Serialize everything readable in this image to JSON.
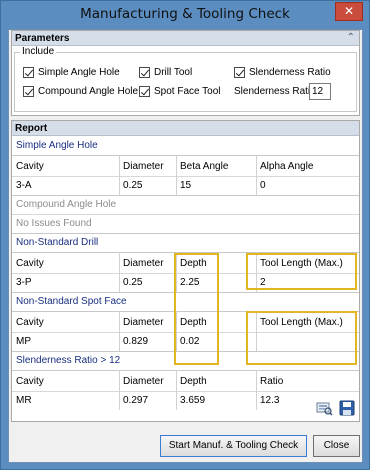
{
  "window": {
    "title": "Manufacturing & Tooling Check",
    "close_glyph": "✕"
  },
  "parameters": {
    "header": "Parameters",
    "collapse_glyph": "⌃",
    "group_label": "Include",
    "checkboxes": [
      {
        "label": "Simple Angle Hole",
        "checked": true
      },
      {
        "label": "Drill Tool",
        "checked": true
      },
      {
        "label": "Slenderness Ratio",
        "checked": true
      },
      {
        "label": "Compound Angle Hole",
        "checked": true
      },
      {
        "label": "Spot Face Tool",
        "checked": true
      }
    ],
    "slenderness_ratio_label": "Slenderness Ratio",
    "slenderness_ratio_value": "12"
  },
  "report": {
    "header": "Report",
    "simple_angle": {
      "title": "Simple Angle Hole",
      "columns": [
        "Cavity",
        "Diameter",
        "Beta Angle",
        "Alpha Angle"
      ],
      "rows": [
        [
          "3-A",
          "0.25",
          "15",
          "0"
        ]
      ]
    },
    "compound_angle": {
      "title": "Compound Angle Hole",
      "message": "No Issues Found"
    },
    "drill": {
      "title": "Non-Standard Drill",
      "columns": [
        "Cavity",
        "Diameter",
        "Depth",
        "Tool Length (Max.)"
      ],
      "rows": [
        [
          "3-P",
          "0.25",
          "2.25",
          "2"
        ]
      ]
    },
    "spot_face": {
      "title": "Non-Standard Spot Face",
      "columns": [
        "Cavity",
        "Diameter",
        "Depth",
        "Tool Length (Max.)"
      ],
      "rows": [
        [
          "MP",
          "0.829",
          "0.02",
          ""
        ]
      ]
    },
    "slenderness": {
      "title": "Slenderness Ratio > 12",
      "columns": [
        "Cavity",
        "Diameter",
        "Depth",
        "Ratio"
      ],
      "rows": [
        [
          "MR",
          "0.297",
          "3.659",
          "12.3"
        ]
      ]
    }
  },
  "buttons": {
    "start": "Start Manuf. & Tooling Check",
    "close": "Close"
  },
  "colors": {
    "highlight": "#e3b521",
    "section_title": "#1a2f80",
    "window_frame": "#5b8dc0"
  }
}
